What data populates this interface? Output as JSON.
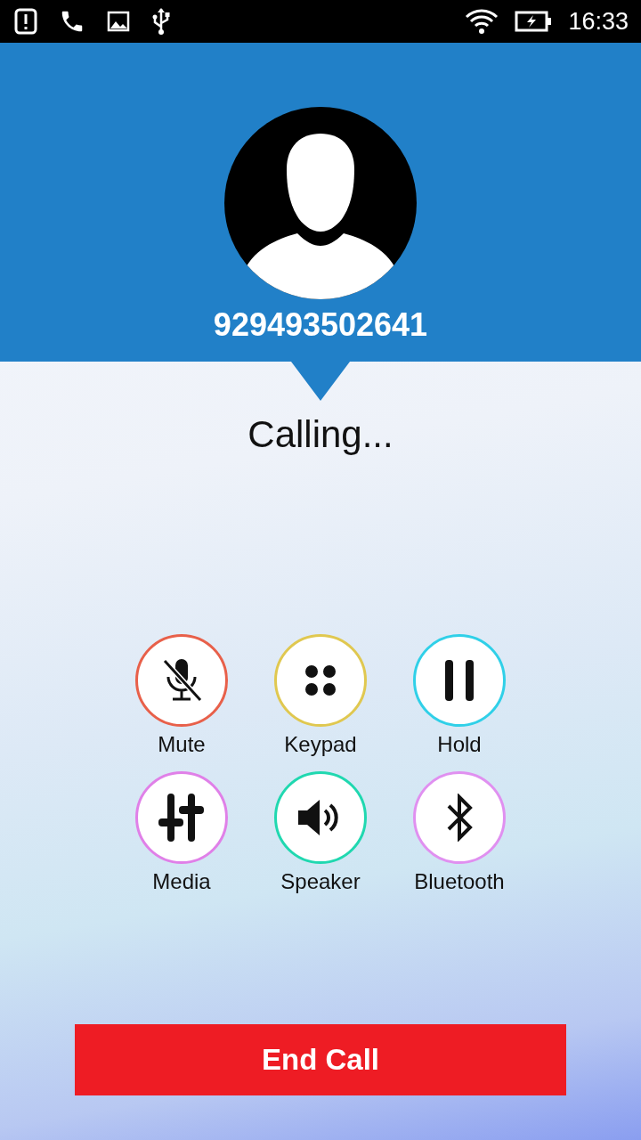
{
  "status_bar": {
    "time": "16:33"
  },
  "contact": {
    "number": "929493502641"
  },
  "call_status": "Calling...",
  "buttons": [
    {
      "kind": "mute",
      "label": "Mute",
      "color": "#e8604a"
    },
    {
      "kind": "keypad",
      "label": "Keypad",
      "color": "#e0c850"
    },
    {
      "kind": "hold",
      "label": "Hold",
      "color": "#30d0e8"
    },
    {
      "kind": "media",
      "label": "Media",
      "color": "#e080e8"
    },
    {
      "kind": "speaker",
      "label": "Speaker",
      "color": "#20d8b0"
    },
    {
      "kind": "bluetooth",
      "label": "Bluetooth",
      "color": "#e090f0"
    }
  ],
  "end_call": {
    "label": "End Call"
  }
}
